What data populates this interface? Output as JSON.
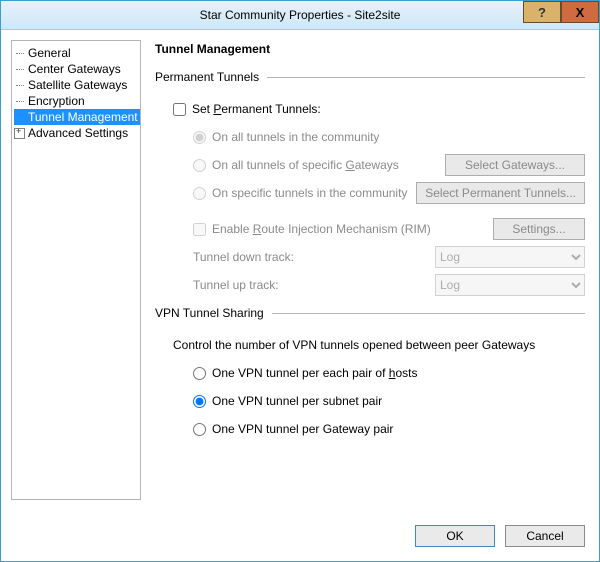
{
  "window": {
    "title": "Star Community Properties - Site2site",
    "help_glyph": "?",
    "close_glyph": "X"
  },
  "tree": {
    "items": [
      {
        "label": "General"
      },
      {
        "label": "Center Gateways"
      },
      {
        "label": "Satellite Gateways"
      },
      {
        "label": "Encryption"
      },
      {
        "label": "Tunnel Management",
        "selected": true
      },
      {
        "label": "Advanced Settings",
        "expandable": true
      }
    ]
  },
  "main": {
    "heading": "Tunnel Management",
    "permanent": {
      "group_label": "Permanent Tunnels",
      "set_label_pre": "Set ",
      "set_label_u": "P",
      "set_label_post": "ermanent Tunnels:",
      "opt_all": "On all tunnels in the community",
      "opt_gw_pre": "On all tunnels of specific ",
      "opt_gw_u": "G",
      "opt_gw_post": "ateways",
      "btn_gw": "Select Gateways...",
      "opt_specific": "On specific tunnels in the community",
      "btn_specific": "Select Permanent Tunnels...",
      "rim_pre": "Enable ",
      "rim_u": "R",
      "rim_post": "oute Injection Mechanism (RIM)",
      "btn_rim": "Settings...",
      "down_label": "Tunnel down track:",
      "down_value": "Log",
      "up_label": "Tunnel up track:",
      "up_value": "Log"
    },
    "sharing": {
      "group_label": "VPN Tunnel Sharing",
      "desc": "Control the number of VPN tunnels opened between peer Gateways",
      "opt_hosts_pre": "One VPN tunnel per each pair of ",
      "opt_hosts_u": "h",
      "opt_hosts_post": "osts",
      "opt_subnet": "One VPN tunnel per subnet pair",
      "opt_gateway": "One VPN tunnel per Gateway pair"
    }
  },
  "footer": {
    "ok": "OK",
    "cancel": "Cancel"
  }
}
